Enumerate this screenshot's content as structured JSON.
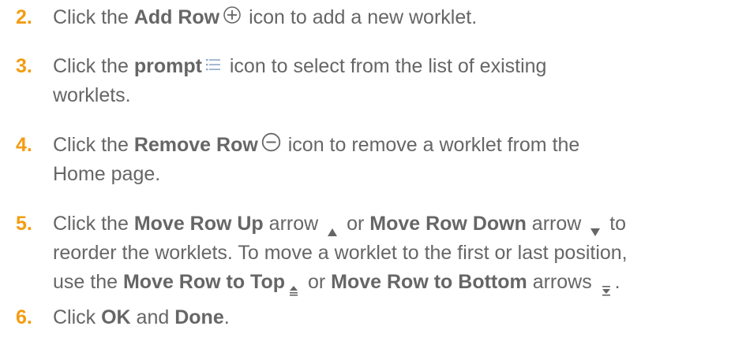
{
  "steps": [
    {
      "num": "2.",
      "pre": "Click the ",
      "bold": "Add Row",
      "post": " icon to add a new worklet.",
      "icon": "add-circle-icon"
    },
    {
      "num": "3.",
      "pre": "Click the ",
      "bold": "prompt",
      "post": " icon to select from the list of existing",
      "line2": "worklets.",
      "icon": "list-icon"
    },
    {
      "num": "4.",
      "pre": "Click the ",
      "bold": "Remove Row",
      "post": " icon to remove a worklet from the",
      "line2": "Home page.",
      "icon": "remove-circle-icon"
    },
    {
      "num": "5.",
      "l1_pre": "Click the ",
      "l1_bold1": "Move Row Up",
      "l1_mid1": " arrow ",
      "l1_mid2": " or ",
      "l1_bold2": "Move Row Down",
      "l1_mid3": " arrow ",
      "l1_end": " to",
      "line2": "reorder the worklets. To move a worklet to the first or last position,",
      "l3_pre": "use the ",
      "l3_bold1": "Move Row to Top",
      "l3_mid": " or ",
      "l3_bold2": "Move Row to Bottom",
      "l3_post": " arrows ",
      "l3_end": ".",
      "icons": [
        "arrow-up-icon",
        "arrow-down-icon",
        "move-to-top-icon",
        "move-to-bottom-icon"
      ]
    },
    {
      "num": "6.",
      "pre": "Click ",
      "bold1": "OK",
      "mid": " and ",
      "bold2": "Done",
      "post": "."
    }
  ],
  "colors": {
    "number": "#F39C12",
    "text": "#666666",
    "icon": "#666666",
    "prompt_icon": "#8fa9c6"
  }
}
